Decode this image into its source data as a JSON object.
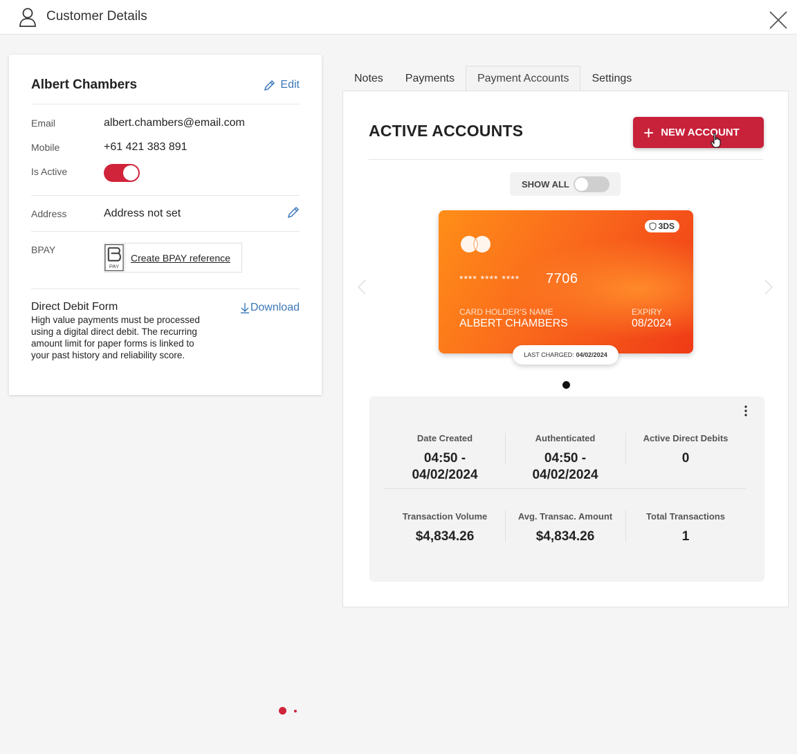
{
  "header": {
    "title": "Customer Details",
    "icons": {
      "user": "user-icon",
      "close": "close-icon"
    }
  },
  "customer": {
    "name": "Albert Chambers",
    "edit_label": "Edit",
    "email_label": "Email",
    "email": "albert.chambers@email.com",
    "mobile_label": "Mobile",
    "mobile": "+61 421 383 891",
    "active_label": "Is Active",
    "is_active": true,
    "address_label": "Address",
    "address": "Address not set",
    "bpay_label": "BPAY",
    "bpay_logo_text": "PAY",
    "bpay_link": "Create BPAY reference",
    "ddf_title": "Direct Debit Form",
    "ddf_description": "High value payments must be processed using a digital direct debit. The recurring amount limit for paper forms is linked to your past history and reliability score.",
    "download_label": "Download"
  },
  "tabs": [
    {
      "label": "Notes",
      "active": false
    },
    {
      "label": "Payments",
      "active": false
    },
    {
      "label": "Payment Accounts",
      "active": true
    },
    {
      "label": "Settings",
      "active": false
    }
  ],
  "accounts": {
    "title": "ACTIVE ACCOUNTS",
    "new_button": "NEW ACCOUNT",
    "show_all_label": "SHOW ALL",
    "show_all": false,
    "card": {
      "badge": "3DS",
      "masked": "**** **** ****",
      "last4": "7706",
      "holder_label": "CARD HOLDER'S NAME",
      "holder": "ALBERT CHAMBERS",
      "expiry_label": "EXPIRY",
      "expiry": "08/2024",
      "last_charged_label": "LAST CHARGED:",
      "last_charged": "04/02/2024"
    },
    "stats": {
      "date_created_label": "Date Created",
      "date_created_time": "04:50 -",
      "date_created_date": "04/02/2024",
      "authenticated_label": "Authenticated",
      "authenticated_time": "04:50 -",
      "authenticated_date": "04/02/2024",
      "active_dd_label": "Active Direct Debits",
      "active_dd": "0",
      "volume_label": "Transaction Volume",
      "volume": "$4,834.26",
      "avg_label": "Avg. Transac. Amount",
      "avg": "$4,834.26",
      "total_label": "Total Transactions",
      "total": "1"
    }
  },
  "colors": {
    "accent": "#c8213a",
    "link": "#3a77b8",
    "card_start": "#ff8e18",
    "card_end": "#ef3a16"
  }
}
